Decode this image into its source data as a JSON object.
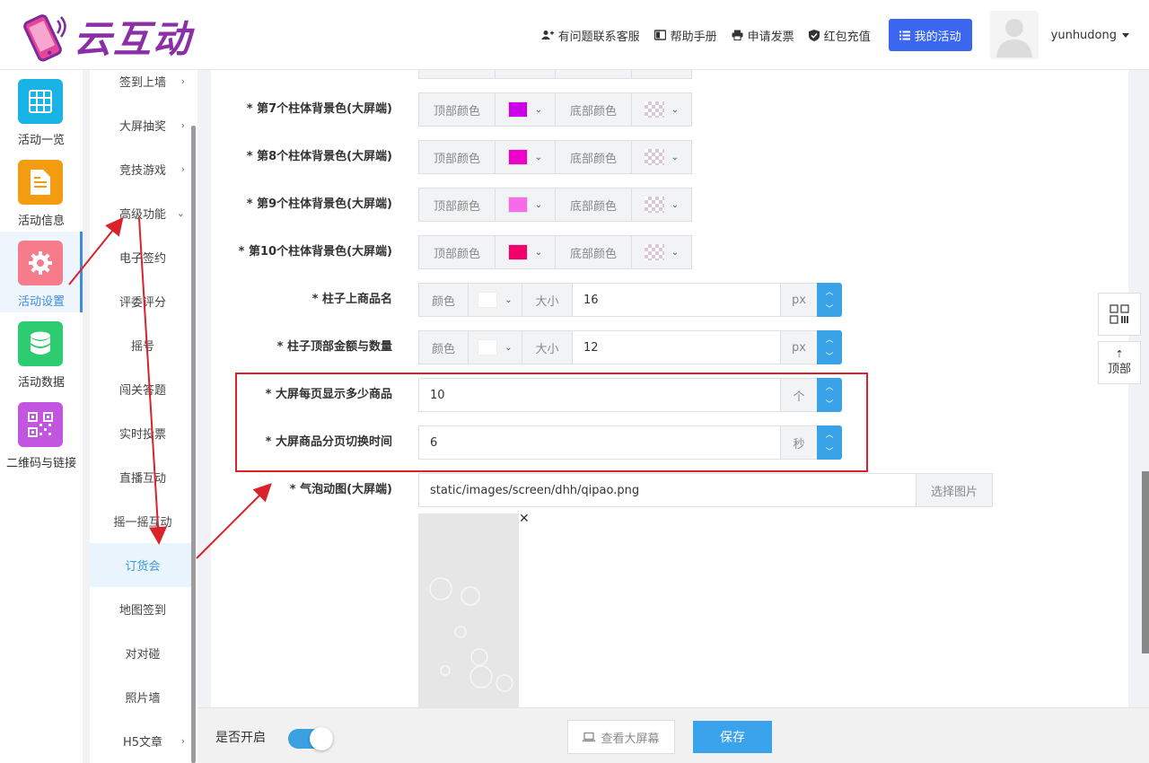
{
  "header": {
    "logo_text": "云互动",
    "nav": {
      "support": "有问题联系客服",
      "manual": "帮助手册",
      "invoice": "申请发票",
      "recharge": "红包充值",
      "my_activity": "我的活动"
    },
    "username": "yunhudong"
  },
  "icon_sidebar": [
    {
      "label": "活动一览",
      "color": "#1ab3e6",
      "icon": "grid-icon"
    },
    {
      "label": "活动信息",
      "color": "#f39c12",
      "icon": "document-icon"
    },
    {
      "label": "活动设置",
      "color": "#f67c8b",
      "icon": "gear-icon"
    },
    {
      "label": "活动数据",
      "color": "#2ecc71",
      "icon": "database-icon"
    },
    {
      "label": "二维码与链接",
      "color": "#c256e0",
      "icon": "qrcode-icon"
    }
  ],
  "submenu": {
    "sign_wall": "签到上墙",
    "lottery": "大屏抽奖",
    "games": "竞技游戏",
    "advanced": "高级功能",
    "esign": "电子签约",
    "judge": "评委评分",
    "shake_number": "摇号",
    "quiz": "闯关答题",
    "vote": "实时投票",
    "live": "直播互动",
    "shake": "摇一摇互动",
    "order": "订货会",
    "map_sign": "地图签到",
    "match": "对对碰",
    "photo_wall": "照片墙",
    "h5": "H5文章"
  },
  "form": {
    "top_color": "顶部颜色",
    "bottom_color": "底部颜色",
    "color": "颜色",
    "size": "大小",
    "px": "px",
    "star": "*",
    "bars": [
      {
        "label": "第7个柱体背景色(大屏端)",
        "top": "#cc00e6"
      },
      {
        "label": "第8个柱体背景色(大屏端)",
        "top": "#ee00c8"
      },
      {
        "label": "第9个柱体背景色(大屏端)",
        "top": "#f76be8"
      },
      {
        "label": "第10个柱体背景色(大屏端)",
        "top": "#f2006e"
      }
    ],
    "product_name": {
      "label": "柱子上商品名",
      "size": "16"
    },
    "top_amount": {
      "label": "柱子顶部金额与数量",
      "size": "12"
    },
    "per_page": {
      "label": "大屏每页显示多少商品",
      "value": "10",
      "unit": "个"
    },
    "switch_time": {
      "label": "大屏商品分页切换时间",
      "value": "6",
      "unit": "秒"
    },
    "bubble": {
      "label": "气泡动图(大屏端)",
      "value": "static/images/screen/dhh/qipao.png",
      "button": "选择图片"
    }
  },
  "bottom": {
    "toggle_label": "是否开启",
    "toggle_on": true,
    "view_screen": "查看大屏幕",
    "save": "保存"
  },
  "float": {
    "top": "顶部"
  }
}
